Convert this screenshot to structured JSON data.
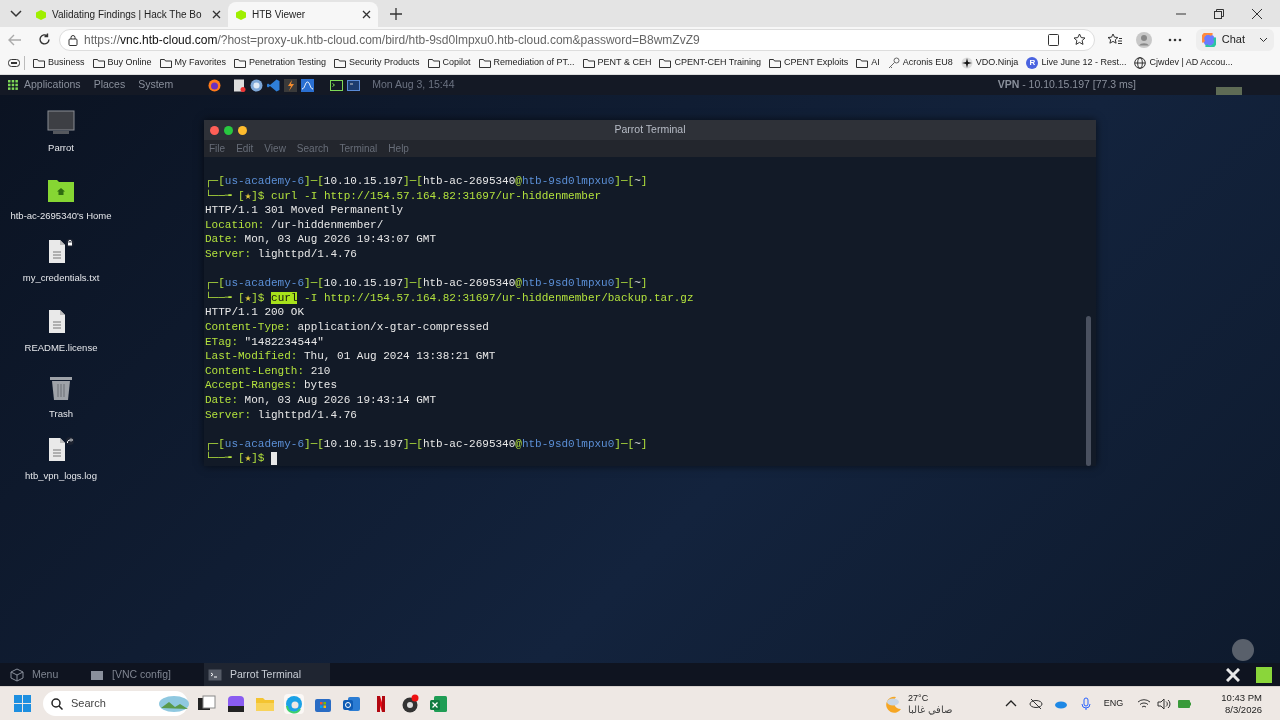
{
  "browser": {
    "tabs": [
      {
        "title": "Validating Findings | Hack The Bo",
        "selected": false
      },
      {
        "title": "HTB Viewer",
        "selected": true
      }
    ],
    "url": {
      "scheme": "https://",
      "domain": "vnc.htb-cloud.com",
      "path": "/?host=proxy-uk.htb-cloud.com/bird/htb-9sd0lmpxu0.htb-cloud.com&password=B8wmZvZ9"
    },
    "chat_button": "Chat",
    "bookmarks": [
      {
        "label": "Business",
        "kind": "folder"
      },
      {
        "label": "Buy Online",
        "kind": "folder"
      },
      {
        "label": "My Favorites",
        "kind": "folder"
      },
      {
        "label": "Penetration Testing",
        "kind": "folder"
      },
      {
        "label": "Security Products",
        "kind": "folder"
      },
      {
        "label": "Copilot",
        "kind": "folder"
      },
      {
        "label": "Remediation of PT...",
        "kind": "folder"
      },
      {
        "label": "PENT & CEH",
        "kind": "folder"
      },
      {
        "label": "CPENT-CEH Training",
        "kind": "folder"
      },
      {
        "label": "CPENT Exploits",
        "kind": "folder"
      },
      {
        "label": "AI",
        "kind": "folder"
      },
      {
        "label": "Acronis EU8",
        "kind": "key"
      },
      {
        "label": "VDO.Ninja",
        "kind": "star"
      },
      {
        "label": "Live June 12 - Rest...",
        "kind": "letter",
        "letter": "R"
      },
      {
        "label": "Cjwdev | AD Accou...",
        "kind": "globe"
      }
    ]
  },
  "top_panel": {
    "menus": [
      "Applications",
      "Places",
      "System"
    ],
    "clock": "Mon Aug 3, 15:44",
    "vpn_label": "VPN",
    "vpn_value": "- 10.10.15.197 [77.3 ms]"
  },
  "desktop_icons": [
    {
      "label": "Parrot",
      "kind": "monitor"
    },
    {
      "label": "htb-ac-2695340's Home",
      "kind": "home"
    },
    {
      "label": "my_credentials.txt",
      "kind": "locked-file"
    },
    {
      "label": "README.license",
      "kind": "file"
    },
    {
      "label": "Trash",
      "kind": "trash"
    },
    {
      "label": "htb_vpn_logs.log",
      "kind": "linked-file"
    }
  ],
  "terminal": {
    "title": "Parrot Terminal",
    "menu": [
      "File",
      "Edit",
      "View",
      "Search",
      "Terminal",
      "Help"
    ],
    "lines": [
      {
        "kind": "text",
        "segments": [
          {
            "kind": "frame",
            "text": "┌─["
          },
          {
            "kind": "user",
            "text": "us-academy-6"
          },
          {
            "kind": "frame",
            "text": "]─["
          },
          {
            "kind": "plain",
            "text": "10.10.15.197"
          },
          {
            "kind": "frame",
            "text": "]─["
          },
          {
            "kind": "plain",
            "text": "htb-ac-2695340"
          },
          {
            "kind": "frame",
            "text": "@"
          },
          {
            "kind": "user",
            "text": "htb-9sd0lmpxu0"
          },
          {
            "kind": "frame",
            "text": "]─["
          },
          {
            "kind": "plain",
            "text": "~"
          },
          {
            "kind": "frame",
            "text": "]"
          }
        ]
      },
      {
        "kind": "text",
        "segments": [
          {
            "kind": "frame",
            "text": "└──╼ ["
          },
          {
            "kind": "star",
            "text": "★"
          },
          {
            "kind": "frame",
            "text": "]$ curl -I http://154.57.164.82:31697/ur-hiddenmember"
          }
        ]
      },
      {
        "kind": "text",
        "segments": [
          {
            "kind": "plain",
            "text": "HTTP/1.1 301 Moved Permanently"
          }
        ]
      },
      {
        "kind": "text",
        "segments": [
          {
            "kind": "frame",
            "text": "Location:"
          },
          {
            "kind": "plain",
            "text": " /ur-hiddenmember/"
          }
        ]
      },
      {
        "kind": "text",
        "segments": [
          {
            "kind": "frame",
            "text": "Date:"
          },
          {
            "kind": "plain",
            "text": " Mon, 03 Aug 2026 19:43:07 GMT"
          }
        ]
      },
      {
        "kind": "text",
        "segments": [
          {
            "kind": "frame",
            "text": "Server:"
          },
          {
            "kind": "plain",
            "text": " lighttpd/1.4.76"
          }
        ]
      },
      {
        "kind": "blank"
      },
      {
        "kind": "text",
        "segments": [
          {
            "kind": "frame",
            "text": "┌─["
          },
          {
            "kind": "user",
            "text": "us-academy-6"
          },
          {
            "kind": "frame",
            "text": "]─["
          },
          {
            "kind": "plain",
            "text": "10.10.15.197"
          },
          {
            "kind": "frame",
            "text": "]─["
          },
          {
            "kind": "plain",
            "text": "htb-ac-2695340"
          },
          {
            "kind": "frame",
            "text": "@"
          },
          {
            "kind": "user",
            "text": "htb-9sd0lmpxu0"
          },
          {
            "kind": "frame",
            "text": "]─["
          },
          {
            "kind": "plain",
            "text": "~"
          },
          {
            "kind": "frame",
            "text": "]"
          }
        ]
      },
      {
        "kind": "text",
        "segments": [
          {
            "kind": "frame",
            "text": "└──╼ ["
          },
          {
            "kind": "star",
            "text": "★"
          },
          {
            "kind": "frame",
            "text": "]$ "
          },
          {
            "kind": "selection",
            "text": "curl"
          },
          {
            "kind": "frame",
            "text": " -I http://154.57.164.82:31697/ur-hiddenmember/backup.tar.gz"
          }
        ]
      },
      {
        "kind": "text",
        "segments": [
          {
            "kind": "plain",
            "text": "HTTP/1.1 200 OK"
          }
        ]
      },
      {
        "kind": "text",
        "segments": [
          {
            "kind": "frame",
            "text": "Content-Type:"
          },
          {
            "kind": "plain",
            "text": " application/x-gtar-compressed"
          }
        ]
      },
      {
        "kind": "text",
        "segments": [
          {
            "kind": "frame",
            "text": "ETag:"
          },
          {
            "kind": "plain",
            "text": " \"1482234544\""
          }
        ]
      },
      {
        "kind": "text",
        "segments": [
          {
            "kind": "frame",
            "text": "Last-Modified:"
          },
          {
            "kind": "plain",
            "text": " Thu, 01 Aug 2024 13:38:21 GMT"
          }
        ]
      },
      {
        "kind": "text",
        "segments": [
          {
            "kind": "frame",
            "text": "Content-Length:"
          },
          {
            "kind": "plain",
            "text": " 210"
          }
        ]
      },
      {
        "kind": "text",
        "segments": [
          {
            "kind": "frame",
            "text": "Accept-Ranges:"
          },
          {
            "kind": "plain",
            "text": " bytes"
          }
        ]
      },
      {
        "kind": "text",
        "segments": [
          {
            "kind": "frame",
            "text": "Date:"
          },
          {
            "kind": "plain",
            "text": " Mon, 03 Aug 2026 19:43:14 GMT"
          }
        ]
      },
      {
        "kind": "text",
        "segments": [
          {
            "kind": "frame",
            "text": "Server:"
          },
          {
            "kind": "plain",
            "text": " lighttpd/1.4.76"
          }
        ]
      },
      {
        "kind": "blank"
      },
      {
        "kind": "text",
        "segments": [
          {
            "kind": "frame",
            "text": "┌─["
          },
          {
            "kind": "user",
            "text": "us-academy-6"
          },
          {
            "kind": "frame",
            "text": "]─["
          },
          {
            "kind": "plain",
            "text": "10.10.15.197"
          },
          {
            "kind": "frame",
            "text": "]─["
          },
          {
            "kind": "plain",
            "text": "htb-ac-2695340"
          },
          {
            "kind": "frame",
            "text": "@"
          },
          {
            "kind": "user",
            "text": "htb-9sd0lmpxu0"
          },
          {
            "kind": "frame",
            "text": "]─["
          },
          {
            "kind": "plain",
            "text": "~"
          },
          {
            "kind": "frame",
            "text": "]"
          }
        ]
      },
      {
        "kind": "text",
        "cursor": true,
        "segments": [
          {
            "kind": "frame",
            "text": "└──╼ ["
          },
          {
            "kind": "star",
            "text": "★"
          },
          {
            "kind": "frame",
            "text": "]$"
          }
        ]
      }
    ]
  },
  "bottom_panel": [
    {
      "label": "Menu",
      "kind": "menu",
      "selected": false
    },
    {
      "label": "[VNC config]",
      "kind": "window",
      "selected": false
    },
    {
      "label": "Parrot Terminal",
      "kind": "terminal",
      "selected": true
    }
  ],
  "windows_taskbar": {
    "search_placeholder": "Search",
    "weather_temp": "27°C",
    "weather_text": "صافي غالبا",
    "language": "ENG",
    "time": "10:43 PM",
    "date": "8/3/2026"
  }
}
